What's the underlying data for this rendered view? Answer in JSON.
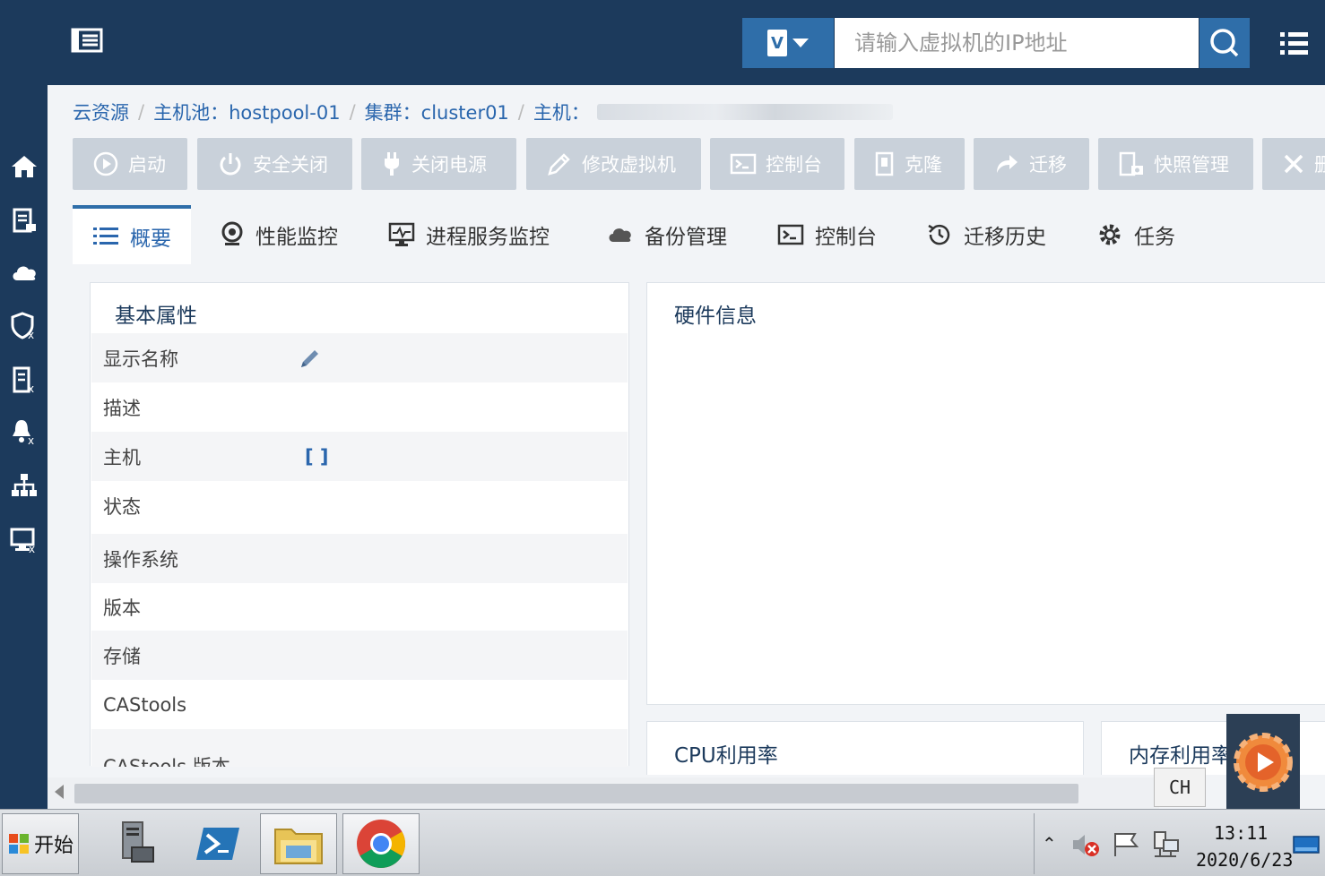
{
  "topbar": {
    "search": {
      "placeholder": "请输入虚拟机的IP地址"
    },
    "vm_type_selector_label": "V"
  },
  "breadcrumb": {
    "items": [
      "云资源",
      "主机池：hostpool-01",
      "集群：cluster01",
      "主机："
    ],
    "separator": "/"
  },
  "toolbar": {
    "buttons": [
      "启动",
      "安全关闭",
      "关闭电源",
      "修改虚拟机",
      "控制台",
      "克隆",
      "迁移",
      "快照管理",
      "删"
    ]
  },
  "tabs": [
    "概要",
    "性能监控",
    "进程服务监控",
    "备份管理",
    "控制台",
    "迁移历史",
    "任务"
  ],
  "basic_panel": {
    "title": "基本属性",
    "rows": [
      "显示名称",
      "描述",
      "主机",
      "状态",
      "操作系统",
      "版本",
      "存储",
      "CAStools",
      "CAStools 版本"
    ],
    "host_value": "[ ]"
  },
  "hardware_panel": {
    "title": "硬件信息"
  },
  "cpu_panel": {
    "title": "CPU利用率"
  },
  "mem_panel": {
    "title": "内存利用率"
  },
  "tray": {
    "ime": "CH",
    "time": "13:11",
    "date": "2020/6/23"
  },
  "taskbar": {
    "start_label": "开始"
  },
  "colors": {
    "header": "#1c3a5c",
    "accent": "#2f6ea9",
    "button": "#c9d1da",
    "link": "#2a66ad"
  }
}
